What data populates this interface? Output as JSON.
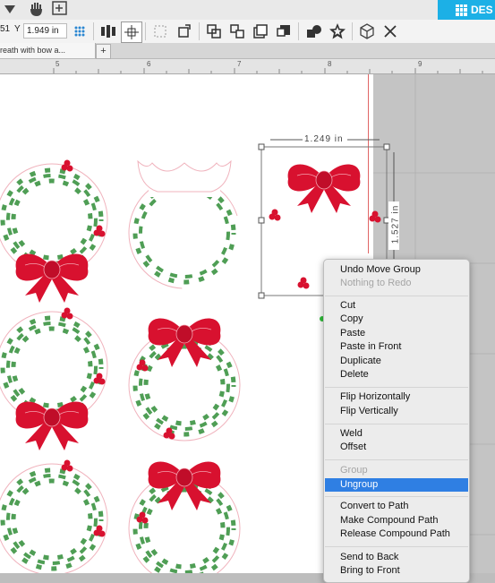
{
  "toolbar": {
    "y_label": "Y",
    "y_value": "1.949",
    "y_unit": "in",
    "design_label": "DES",
    "x_fragment": "51"
  },
  "tabs": {
    "doc_title": "reath with bow a...",
    "add_tab": "+"
  },
  "ruler": {
    "ticks": [
      "5",
      "6",
      "7",
      "8",
      "9"
    ]
  },
  "dims": {
    "width": "1.249 in",
    "height": "1.527 in"
  },
  "context_menu": {
    "items": [
      {
        "label": "Undo Move Group",
        "enabled": true
      },
      {
        "label": "Nothing to Redo",
        "enabled": false
      },
      {
        "label": "Cut",
        "enabled": true
      },
      {
        "label": "Copy",
        "enabled": true
      },
      {
        "label": "Paste",
        "enabled": true
      },
      {
        "label": "Paste in Front",
        "enabled": true
      },
      {
        "label": "Duplicate",
        "enabled": true
      },
      {
        "label": "Delete",
        "enabled": true
      },
      {
        "label": "Flip Horizontally",
        "enabled": true
      },
      {
        "label": "Flip Vertically",
        "enabled": true
      },
      {
        "label": "Weld",
        "enabled": true
      },
      {
        "label": "Offset",
        "enabled": true
      },
      {
        "label": "Group",
        "enabled": false
      },
      {
        "label": "Ungroup",
        "enabled": true,
        "highlighted": true
      },
      {
        "label": "Convert to Path",
        "enabled": true
      },
      {
        "label": "Make Compound Path",
        "enabled": true
      },
      {
        "label": "Release Compound Path",
        "enabled": true
      },
      {
        "label": "Send to Back",
        "enabled": true
      },
      {
        "label": "Bring to Front",
        "enabled": true
      }
    ]
  },
  "colors": {
    "accent": "#1cb0e6",
    "highlight": "#2f7fe3",
    "bow": "#d8112f",
    "leaf": "#4f9e55",
    "cut": "#e06666"
  }
}
